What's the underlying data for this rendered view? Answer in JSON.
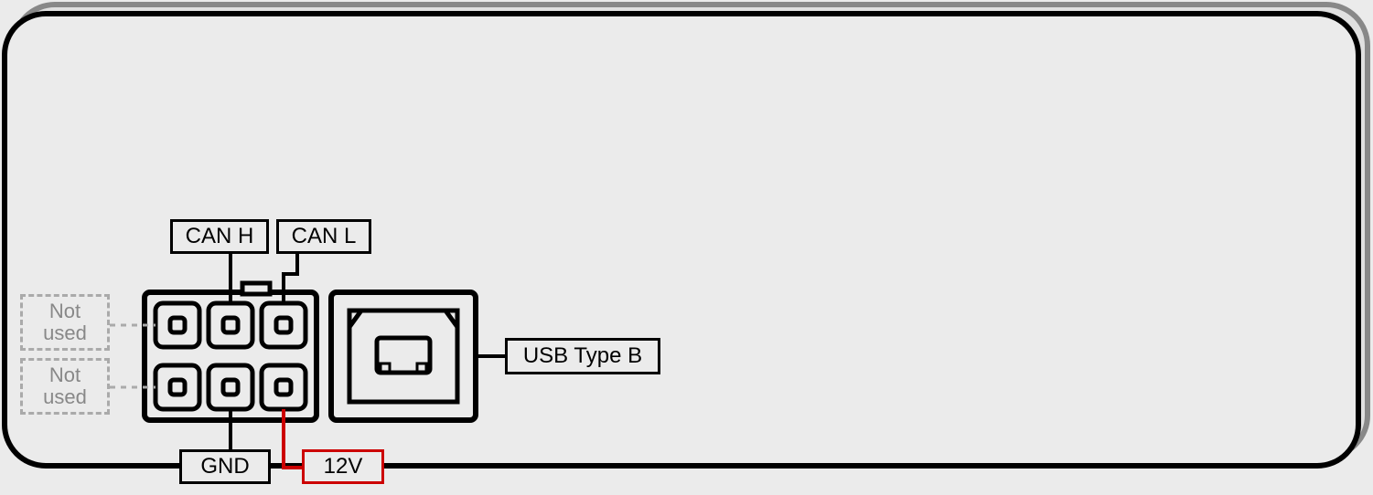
{
  "diagram": {
    "enclosure": {
      "outer_radius": 40,
      "stroke": "#888",
      "fill": "#e0e0e0"
    },
    "labels": {
      "can_h": "CAN H",
      "can_l": "CAN L",
      "gnd": "GND",
      "v12": "12V",
      "usb": "USB Type B",
      "not_used_1_line1": "Not",
      "not_used_1_line2": "used",
      "not_used_2_line1": "Not",
      "not_used_2_line2": "used"
    },
    "connectors": {
      "header_6pin": {
        "pins": [
          {
            "row": 0,
            "col": 0,
            "name": "not_used_top"
          },
          {
            "row": 0,
            "col": 1,
            "name": "can_h"
          },
          {
            "row": 0,
            "col": 2,
            "name": "can_l"
          },
          {
            "row": 1,
            "col": 0,
            "name": "not_used_bot"
          },
          {
            "row": 1,
            "col": 1,
            "name": "gnd"
          },
          {
            "row": 1,
            "col": 2,
            "name": "12v"
          }
        ]
      },
      "usb_type_b": {
        "type": "USB-B"
      }
    },
    "chart_data": null
  }
}
